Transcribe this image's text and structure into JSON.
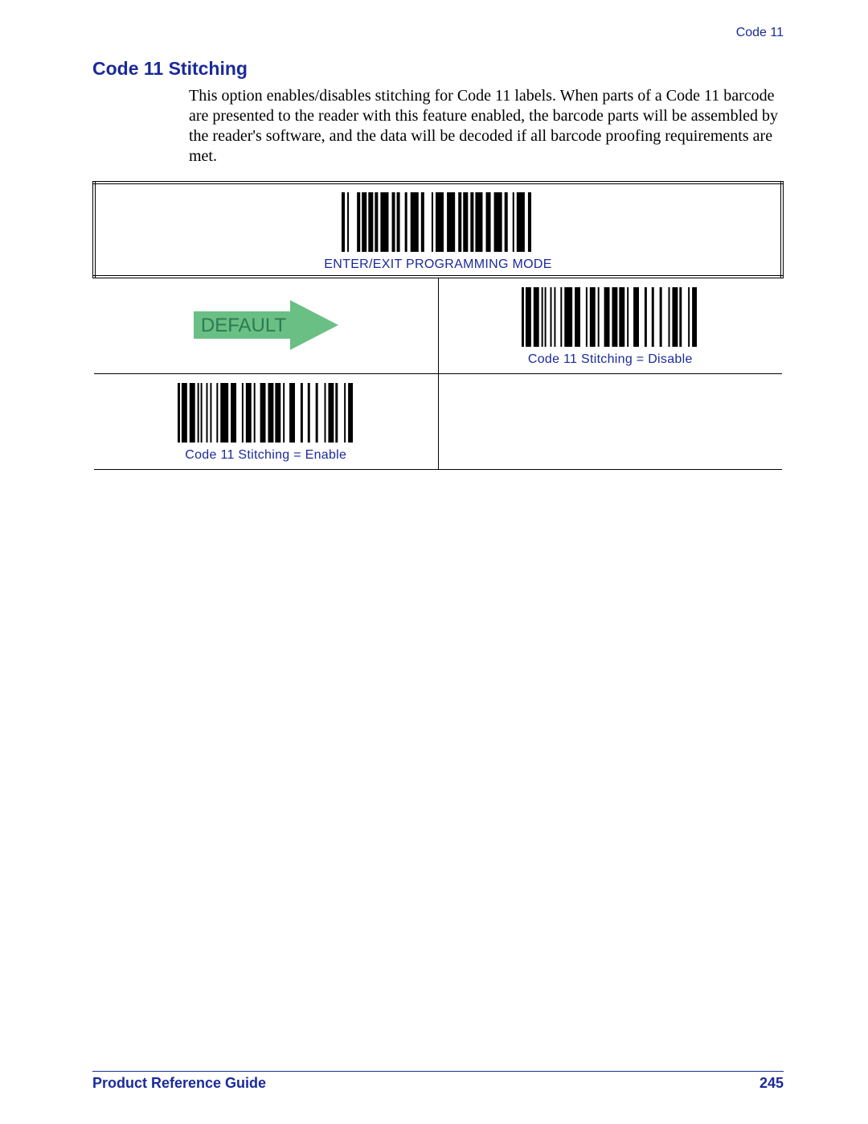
{
  "header": {
    "section_label": "Code 11"
  },
  "section": {
    "heading": "Code 11 Stitching",
    "body": "This option enables/disables stitching for Code 11 labels. When parts of a Code 11 barcode are presented to the reader with this feature enabled, the barcode parts will be assembled by the reader's software, and the data will be decoded if all barcode proofing requirements are met."
  },
  "barcodes": {
    "enter_exit_caption": "ENTER/EXIT PROGRAMMING MODE",
    "enter_exit_widths": [
      4,
      3,
      2,
      10,
      4,
      2,
      6,
      2,
      6,
      2,
      4,
      3,
      10,
      4,
      4,
      2,
      4,
      6,
      3,
      4,
      10,
      3,
      4,
      9,
      2,
      3,
      10,
      4,
      10,
      4,
      4,
      2,
      6,
      3,
      4,
      2,
      9,
      4,
      6,
      4,
      10,
      3,
      4,
      6,
      2,
      3,
      10,
      4,
      4,
      4
    ],
    "disable_caption": "Code 11 Stitching = Disable",
    "disable_widths": [
      3,
      2,
      7,
      3,
      7,
      3,
      2,
      2,
      2,
      5,
      2,
      3,
      2,
      6,
      2,
      3,
      10,
      3,
      7,
      7,
      2,
      3,
      7,
      3,
      2,
      6,
      7,
      3,
      7,
      2,
      7,
      3,
      2,
      6,
      7,
      7,
      3,
      6,
      3,
      7,
      3,
      8,
      2,
      3,
      7,
      2,
      3,
      8,
      2,
      3,
      6,
      2
    ],
    "enable_caption": "Code 11 Stitching = Enable",
    "enable_widths": [
      3,
      2,
      7,
      3,
      7,
      3,
      2,
      2,
      2,
      5,
      2,
      3,
      2,
      6,
      2,
      3,
      10,
      3,
      7,
      7,
      2,
      3,
      7,
      3,
      2,
      6,
      7,
      3,
      7,
      2,
      7,
      3,
      2,
      6,
      7,
      7,
      3,
      6,
      3,
      7,
      3,
      8,
      2,
      3,
      7,
      2,
      3,
      8,
      2,
      3,
      6,
      2
    ],
    "default_label": "DEFAULT"
  },
  "footer": {
    "guide": "Product Reference Guide",
    "page_number": "245"
  }
}
